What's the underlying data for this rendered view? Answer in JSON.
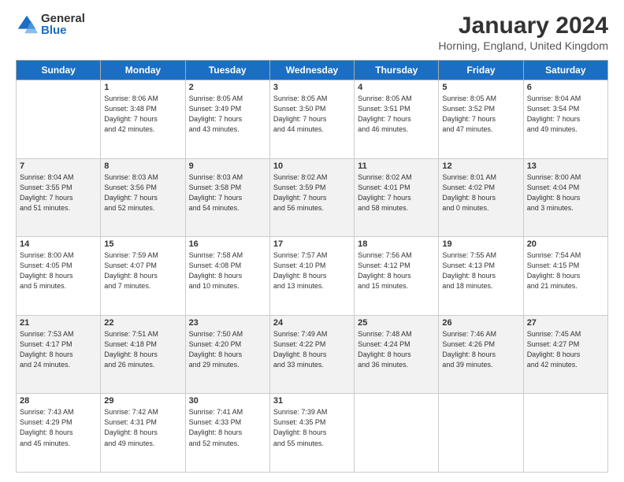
{
  "logo": {
    "general": "General",
    "blue": "Blue"
  },
  "title": "January 2024",
  "location": "Horning, England, United Kingdom",
  "days_of_week": [
    "Sunday",
    "Monday",
    "Tuesday",
    "Wednesday",
    "Thursday",
    "Friday",
    "Saturday"
  ],
  "weeks": [
    [
      {
        "day": "",
        "info": ""
      },
      {
        "day": "1",
        "info": "Sunrise: 8:06 AM\nSunset: 3:48 PM\nDaylight: 7 hours\nand 42 minutes."
      },
      {
        "day": "2",
        "info": "Sunrise: 8:05 AM\nSunset: 3:49 PM\nDaylight: 7 hours\nand 43 minutes."
      },
      {
        "day": "3",
        "info": "Sunrise: 8:05 AM\nSunset: 3:50 PM\nDaylight: 7 hours\nand 44 minutes."
      },
      {
        "day": "4",
        "info": "Sunrise: 8:05 AM\nSunset: 3:51 PM\nDaylight: 7 hours\nand 46 minutes."
      },
      {
        "day": "5",
        "info": "Sunrise: 8:05 AM\nSunset: 3:52 PM\nDaylight: 7 hours\nand 47 minutes."
      },
      {
        "day": "6",
        "info": "Sunrise: 8:04 AM\nSunset: 3:54 PM\nDaylight: 7 hours\nand 49 minutes."
      }
    ],
    [
      {
        "day": "7",
        "info": "Sunrise: 8:04 AM\nSunset: 3:55 PM\nDaylight: 7 hours\nand 51 minutes."
      },
      {
        "day": "8",
        "info": "Sunrise: 8:03 AM\nSunset: 3:56 PM\nDaylight: 7 hours\nand 52 minutes."
      },
      {
        "day": "9",
        "info": "Sunrise: 8:03 AM\nSunset: 3:58 PM\nDaylight: 7 hours\nand 54 minutes."
      },
      {
        "day": "10",
        "info": "Sunrise: 8:02 AM\nSunset: 3:59 PM\nDaylight: 7 hours\nand 56 minutes."
      },
      {
        "day": "11",
        "info": "Sunrise: 8:02 AM\nSunset: 4:01 PM\nDaylight: 7 hours\nand 58 minutes."
      },
      {
        "day": "12",
        "info": "Sunrise: 8:01 AM\nSunset: 4:02 PM\nDaylight: 8 hours\nand 0 minutes."
      },
      {
        "day": "13",
        "info": "Sunrise: 8:00 AM\nSunset: 4:04 PM\nDaylight: 8 hours\nand 3 minutes."
      }
    ],
    [
      {
        "day": "14",
        "info": "Sunrise: 8:00 AM\nSunset: 4:05 PM\nDaylight: 8 hours\nand 5 minutes."
      },
      {
        "day": "15",
        "info": "Sunrise: 7:59 AM\nSunset: 4:07 PM\nDaylight: 8 hours\nand 7 minutes."
      },
      {
        "day": "16",
        "info": "Sunrise: 7:58 AM\nSunset: 4:08 PM\nDaylight: 8 hours\nand 10 minutes."
      },
      {
        "day": "17",
        "info": "Sunrise: 7:57 AM\nSunset: 4:10 PM\nDaylight: 8 hours\nand 13 minutes."
      },
      {
        "day": "18",
        "info": "Sunrise: 7:56 AM\nSunset: 4:12 PM\nDaylight: 8 hours\nand 15 minutes."
      },
      {
        "day": "19",
        "info": "Sunrise: 7:55 AM\nSunset: 4:13 PM\nDaylight: 8 hours\nand 18 minutes."
      },
      {
        "day": "20",
        "info": "Sunrise: 7:54 AM\nSunset: 4:15 PM\nDaylight: 8 hours\nand 21 minutes."
      }
    ],
    [
      {
        "day": "21",
        "info": "Sunrise: 7:53 AM\nSunset: 4:17 PM\nDaylight: 8 hours\nand 24 minutes."
      },
      {
        "day": "22",
        "info": "Sunrise: 7:51 AM\nSunset: 4:18 PM\nDaylight: 8 hours\nand 26 minutes."
      },
      {
        "day": "23",
        "info": "Sunrise: 7:50 AM\nSunset: 4:20 PM\nDaylight: 8 hours\nand 29 minutes."
      },
      {
        "day": "24",
        "info": "Sunrise: 7:49 AM\nSunset: 4:22 PM\nDaylight: 8 hours\nand 33 minutes."
      },
      {
        "day": "25",
        "info": "Sunrise: 7:48 AM\nSunset: 4:24 PM\nDaylight: 8 hours\nand 36 minutes."
      },
      {
        "day": "26",
        "info": "Sunrise: 7:46 AM\nSunset: 4:26 PM\nDaylight: 8 hours\nand 39 minutes."
      },
      {
        "day": "27",
        "info": "Sunrise: 7:45 AM\nSunset: 4:27 PM\nDaylight: 8 hours\nand 42 minutes."
      }
    ],
    [
      {
        "day": "28",
        "info": "Sunrise: 7:43 AM\nSunset: 4:29 PM\nDaylight: 8 hours\nand 45 minutes."
      },
      {
        "day": "29",
        "info": "Sunrise: 7:42 AM\nSunset: 4:31 PM\nDaylight: 8 hours\nand 49 minutes."
      },
      {
        "day": "30",
        "info": "Sunrise: 7:41 AM\nSunset: 4:33 PM\nDaylight: 8 hours\nand 52 minutes."
      },
      {
        "day": "31",
        "info": "Sunrise: 7:39 AM\nSunset: 4:35 PM\nDaylight: 8 hours\nand 55 minutes."
      },
      {
        "day": "",
        "info": ""
      },
      {
        "day": "",
        "info": ""
      },
      {
        "day": "",
        "info": ""
      }
    ]
  ]
}
